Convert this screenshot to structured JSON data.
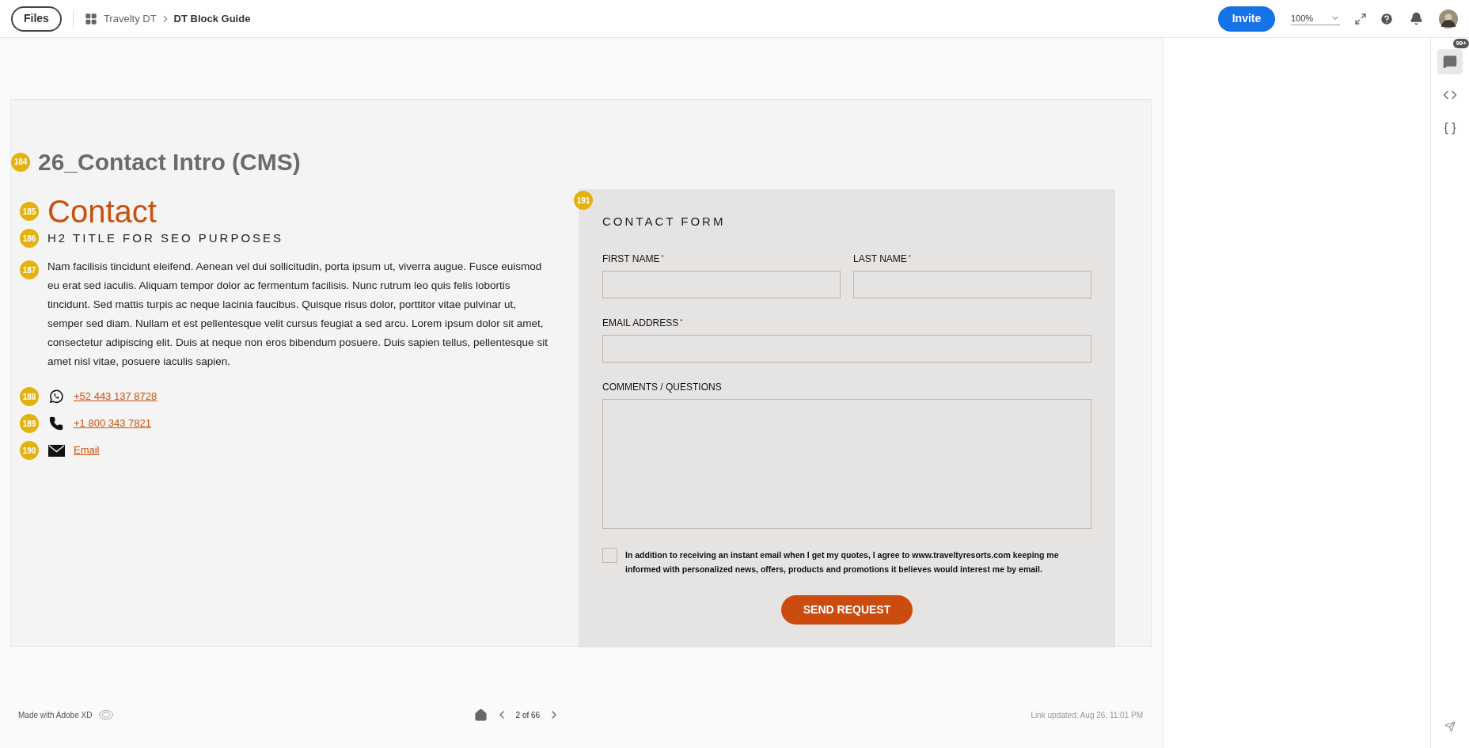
{
  "topbar": {
    "files_button": "Files",
    "breadcrumb": [
      {
        "label": "Travelty DT",
        "current": false
      },
      {
        "label": "DT Block Guide",
        "current": true
      }
    ],
    "invite_button": "Invite",
    "zoom": "100%"
  },
  "artboard": {
    "title_badge": "184",
    "title": "26_Contact Intro (CMS)",
    "heading": {
      "badge": "185",
      "text": "Contact"
    },
    "subheading": {
      "badge": "186",
      "text": "H2 TITLE FOR SEO PURPOSES"
    },
    "paragraph": {
      "badge": "187",
      "text": "Nam facilisis tincidunt eleifend. Aenean vel dui sollicitudin, porta ipsum ut, viverra augue. Fusce euismod eu erat sed iaculis. Aliquam tempor dolor ac fermentum facilisis. Nunc rutrum leo quis felis lobortis tincidunt. Sed mattis turpis ac neque lacinia faucibus. Quisque risus dolor, porttitor vitae pulvinar ut, semper sed diam. Nullam et est pellentesque velit cursus feugiat a sed arcu. Lorem ipsum dolor sit amet, consectetur adipiscing elit. Duis at neque non eros bibendum posuere. Duis sapien tellus, pellentesque sit amet nisl vitae, posuere iaculis sapien."
    },
    "contacts": [
      {
        "badge": "188",
        "kind": "whatsapp",
        "label": "+52 443 137 8728"
      },
      {
        "badge": "189",
        "kind": "phone",
        "label": "+1 800 343 7821"
      },
      {
        "badge": "190",
        "kind": "email",
        "label": "Email"
      }
    ],
    "form": {
      "badge": "191",
      "title": "CONTACT FORM",
      "fields": [
        {
          "label": "FIRST NAME",
          "required_mark": "*",
          "kind": "half"
        },
        {
          "label": "LAST NAME",
          "required_mark": "*",
          "kind": "half"
        },
        {
          "label": "EMAIL ADDRESS",
          "required_mark": "*",
          "kind": "full"
        },
        {
          "label": "COMMENTS / QUESTIONS",
          "kind": "textarea"
        }
      ],
      "consent": {
        "checked": false,
        "text": "In addition to receiving an instant email when I get my quotes, I agree to www.traveltyresorts.com keeping me informed with personalized news, offers, products and promotions it believes would interest me by email."
      },
      "submit": "SEND REQUEST"
    }
  },
  "footer": {
    "made_with": "Made with Adobe XD",
    "page": "2 of 66",
    "updated": "Link updated: Aug 26, 11:01 PM"
  },
  "side_tabs": [
    {
      "kind": "comments",
      "selected": true,
      "badge": "99+"
    },
    {
      "kind": "code",
      "selected": false
    },
    {
      "kind": "specs",
      "selected": false
    }
  ]
}
